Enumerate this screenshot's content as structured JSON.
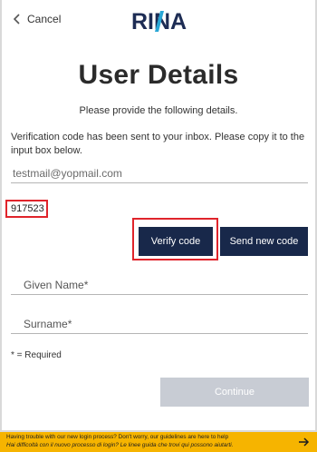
{
  "header": {
    "cancel_label": "Cancel",
    "logo_text": "RINA"
  },
  "main": {
    "title": "User Details",
    "subtitle": "Please provide the following details.",
    "info_text": "Verification code has been sent to your inbox. Please copy it to the input box below.",
    "email_value": "testmail@yopmail.com",
    "verification_code": "917523",
    "verify_label": "Verify code",
    "send_new_label": "Send new code",
    "given_name_placeholder": "Given Name*",
    "surname_placeholder": "Surname*",
    "required_note": "* = Required",
    "continue_label": "Continue"
  },
  "banner": {
    "line1": "Having trouble with our new login process? Don't worry, our guidelines are here to help",
    "line2": "Hai difficoltà con il nuovo processo di login? Le linee guida che trovi qui possono aiutarti."
  },
  "colors": {
    "primary": "#18284a",
    "highlight": "#e0242b",
    "disabled": "#c8ccd4",
    "banner": "#f6b400",
    "logo_accent": "#2aa7d6"
  }
}
